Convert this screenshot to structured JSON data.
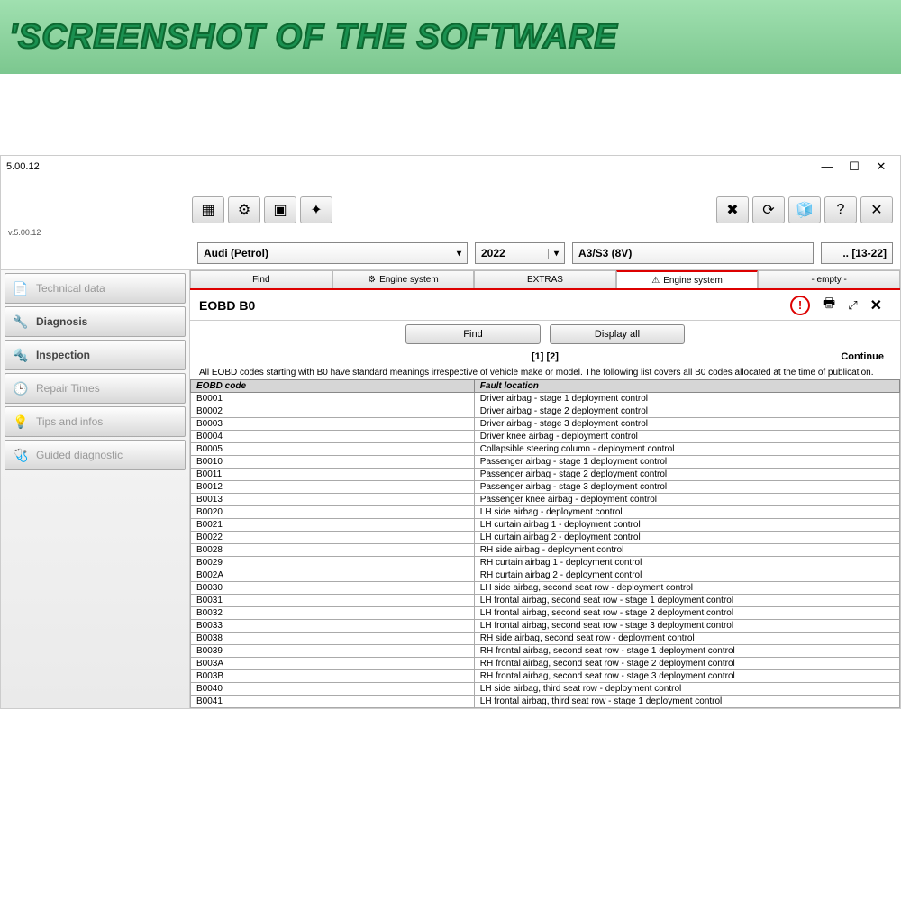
{
  "banner": {
    "text": "'SCREENSHOT OF THE SOFTWARE"
  },
  "window": {
    "title": "5.00.12",
    "version_small": "v.5.00.12"
  },
  "selectors": {
    "make": "Audi (Petrol)",
    "year": "2022",
    "model": "A3/S3 (8V)",
    "range": ".. [13-22]"
  },
  "sidebar": {
    "items": [
      {
        "icon": "📄",
        "label": "Technical data",
        "faded": true
      },
      {
        "icon": "🔧",
        "label": "Diagnosis",
        "faded": false
      },
      {
        "icon": "🔩",
        "label": "Inspection",
        "faded": false
      },
      {
        "icon": "🕒",
        "label": "Repair Times",
        "faded": true
      },
      {
        "icon": "💡",
        "label": "Tips and infos",
        "faded": true
      },
      {
        "icon": "🩺",
        "label": "Guided diagnostic",
        "faded": true
      }
    ]
  },
  "tabs": [
    {
      "label": "Find",
      "icon": ""
    },
    {
      "label": "Engine system",
      "icon": "⚙"
    },
    {
      "label": "EXTRAS",
      "icon": ""
    },
    {
      "label": "Engine system",
      "icon": "⚠",
      "active": true
    },
    {
      "label": "- empty -",
      "icon": ""
    }
  ],
  "section": {
    "title": "EOBD B0",
    "find_btn": "Find",
    "display_all_btn": "Display all",
    "pager": "[1] [2]",
    "continue": "Continue",
    "note": "All EOBD codes starting with B0 have standard meanings irrespective of vehicle make or model. The following list covers all B0 codes allocated at the time of publication."
  },
  "table": {
    "headers": [
      "EOBD code",
      "Fault location"
    ],
    "rows": [
      [
        "B0001",
        "Driver airbag - stage 1 deployment control"
      ],
      [
        "B0002",
        "Driver airbag - stage 2 deployment control"
      ],
      [
        "B0003",
        "Driver airbag - stage 3 deployment control"
      ],
      [
        "B0004",
        "Driver knee airbag - deployment control"
      ],
      [
        "B0005",
        "Collapsible steering column - deployment control"
      ],
      [
        "B0010",
        "Passenger airbag - stage 1 deployment control"
      ],
      [
        "B0011",
        "Passenger airbag - stage 2 deployment control"
      ],
      [
        "B0012",
        "Passenger airbag - stage 3 deployment control"
      ],
      [
        "B0013",
        "Passenger knee airbag - deployment control"
      ],
      [
        "B0020",
        "LH side airbag - deployment control"
      ],
      [
        "B0021",
        "LH curtain airbag 1 - deployment control"
      ],
      [
        "B0022",
        "LH curtain airbag 2 - deployment control"
      ],
      [
        "B0028",
        "RH side airbag - deployment control"
      ],
      [
        "B0029",
        "RH curtain airbag 1 - deployment control"
      ],
      [
        "B002A",
        "RH curtain airbag 2 - deployment control"
      ],
      [
        "B0030",
        "LH side airbag, second seat row - deployment control"
      ],
      [
        "B0031",
        "LH frontal airbag, second seat row - stage 1 deployment control"
      ],
      [
        "B0032",
        "LH frontal airbag, second seat row - stage 2 deployment control"
      ],
      [
        "B0033",
        "LH frontal airbag, second seat row - stage 3 deployment control"
      ],
      [
        "B0038",
        "RH side airbag, second seat row - deployment control"
      ],
      [
        "B0039",
        "RH frontal airbag, second seat row - stage 1 deployment control"
      ],
      [
        "B003A",
        "RH frontal airbag, second seat row - stage 2 deployment control"
      ],
      [
        "B003B",
        "RH frontal airbag, second seat row - stage 3 deployment control"
      ],
      [
        "B0040",
        "LH side airbag, third seat row - deployment control"
      ],
      [
        "B0041",
        "LH frontal airbag, third seat row - stage 1 deployment control"
      ]
    ]
  }
}
